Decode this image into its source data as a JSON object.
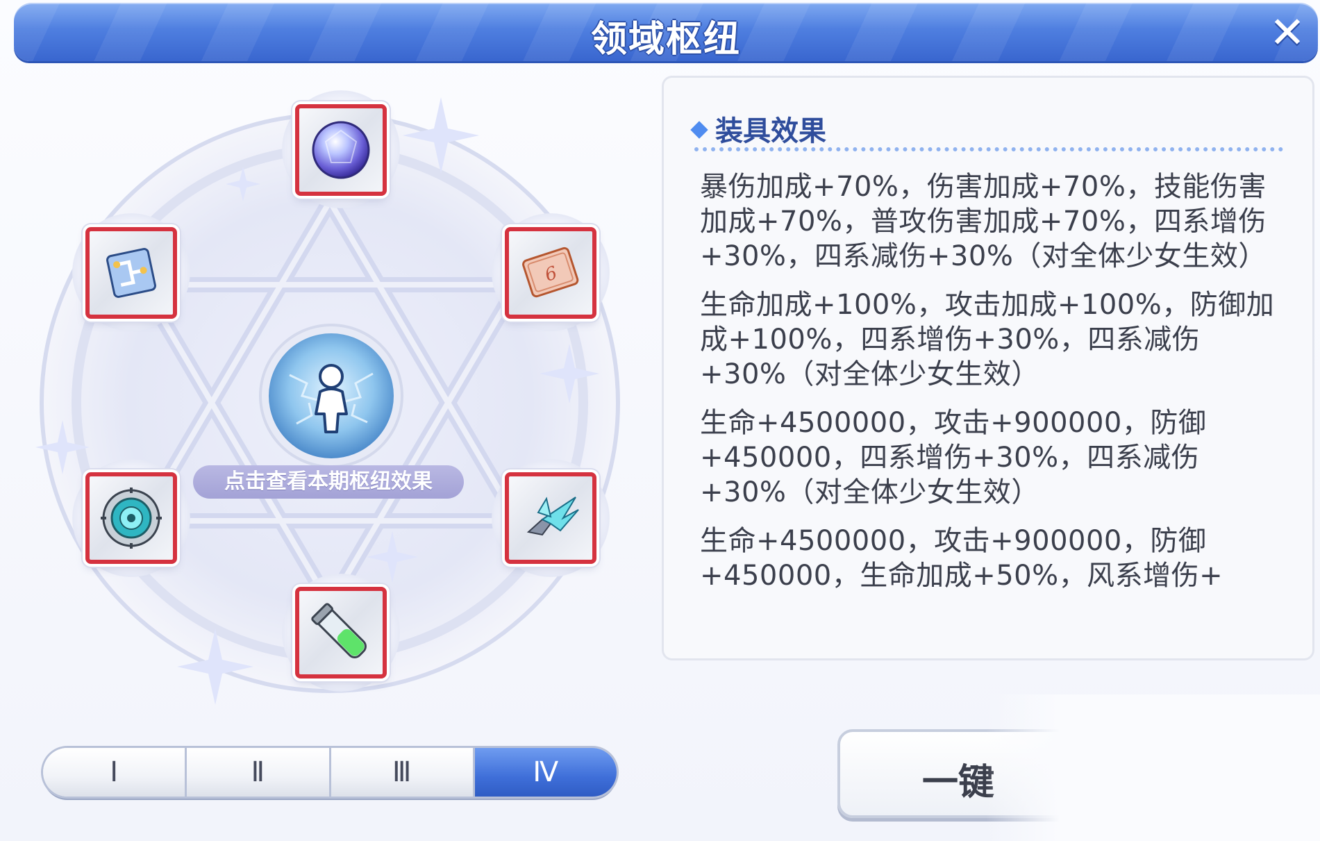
{
  "window": {
    "title": "领域枢纽",
    "close_icon": "close-icon"
  },
  "hub": {
    "center_label": "点击查看本期枢纽效果",
    "center_icon": "energy-figure-icon",
    "slots": [
      {
        "icon": "crystal-orb-icon"
      },
      {
        "icon": "dice-card-icon"
      },
      {
        "icon": "crystal-wing-icon"
      },
      {
        "icon": "green-vial-icon"
      },
      {
        "icon": "gear-core-icon"
      },
      {
        "icon": "circuit-chip-icon"
      }
    ]
  },
  "tabs": [
    {
      "label": "Ⅰ",
      "active": false
    },
    {
      "label": "Ⅱ",
      "active": false
    },
    {
      "label": "Ⅲ",
      "active": false
    },
    {
      "label": "Ⅳ",
      "active": true
    }
  ],
  "effects": {
    "header": "装具效果",
    "items": [
      "暴伤加成+70%，伤害加成+70%，技能伤害加成+70%，普攻伤害加成+70%，四系增伤+30%，四系减伤+30%（对全体少女生效）",
      "生命加成+100%，攻击加成+100%，防御加成+100%，四系增伤+30%，四系减伤+30%（对全体少女生效）",
      "生命+4500000，攻击+900000，防御+450000，四系增伤+30%，四系减伤+30%（对全体少女生效）",
      "生命+4500000，攻击+900000，防御+450000，生命加成+50%，风系增伤+"
    ]
  },
  "actions": {
    "one_key_label": "一键"
  },
  "colors": {
    "title_bar": "#4f7fe0",
    "slot_border": "#d5323f",
    "tab_active": "#3f6fd9",
    "effect_header": "#2f4d9c"
  }
}
